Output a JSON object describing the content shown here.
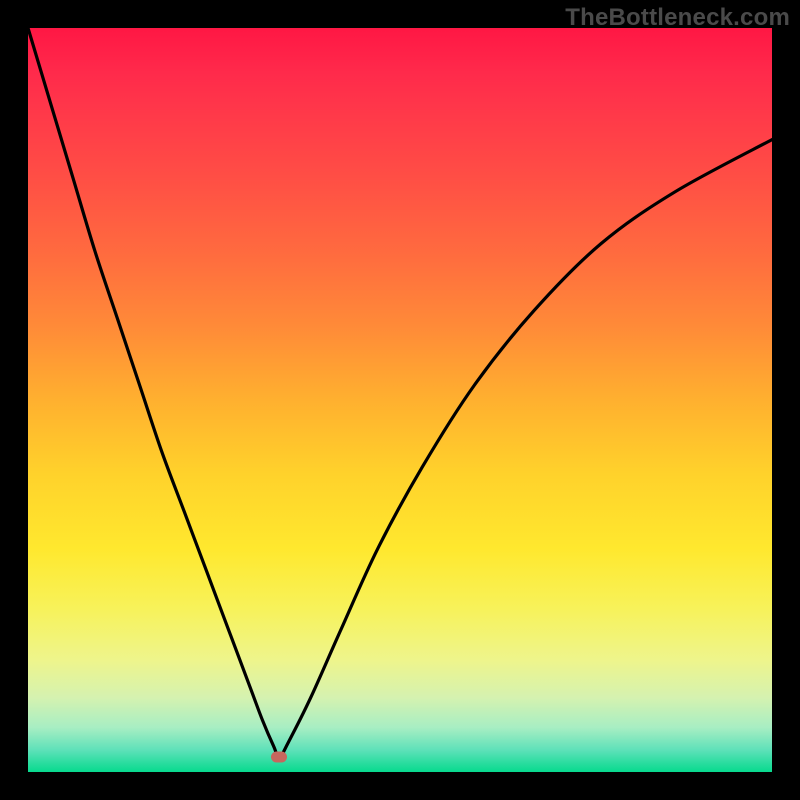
{
  "watermark": "TheBottleneck.com",
  "colors": {
    "frame": "#000000",
    "curve": "#000000",
    "marker": "#c6675d",
    "gradient_top": "#ff1744",
    "gradient_bottom": "#07da8e"
  },
  "chart_data": {
    "type": "line",
    "title": "",
    "xlabel": "",
    "ylabel": "",
    "xlim": [
      0,
      100
    ],
    "ylim": [
      0,
      100
    ],
    "grid": false,
    "legend": false,
    "annotations": [
      {
        "name": "minimum-marker",
        "x": 33.8,
        "y": 2
      }
    ],
    "series": [
      {
        "name": "bottleneck-curve",
        "x": [
          0,
          3,
          6,
          9,
          12,
          15,
          18,
          21,
          24,
          27,
          30,
          31.5,
          33,
          33.8,
          35,
          38,
          42,
          47,
          53,
          60,
          68,
          77,
          87,
          100
        ],
        "y": [
          100,
          90,
          80,
          70,
          61,
          52,
          43,
          35,
          27,
          19,
          11,
          7,
          3.5,
          2,
          4,
          10,
          19,
          30,
          41,
          52,
          62,
          71,
          78,
          85
        ]
      }
    ]
  }
}
